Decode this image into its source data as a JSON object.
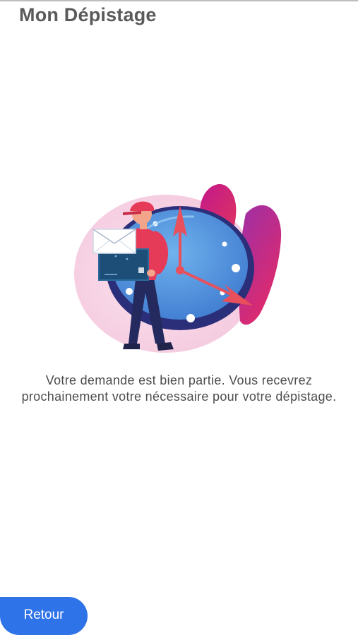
{
  "header": {
    "title": "Mon Dépistage"
  },
  "confirmation": {
    "message": "Votre demande est bien partie. Vous recevrez prochainement votre nécessaire pour votre dépistage."
  },
  "footer": {
    "back_label": "Retour"
  },
  "colors": {
    "accent": "#2f73e8",
    "title_text": "#5a5a5a",
    "body_text": "#4d4d4d"
  },
  "illustration": {
    "icon": "delivery-clock-illustration"
  }
}
